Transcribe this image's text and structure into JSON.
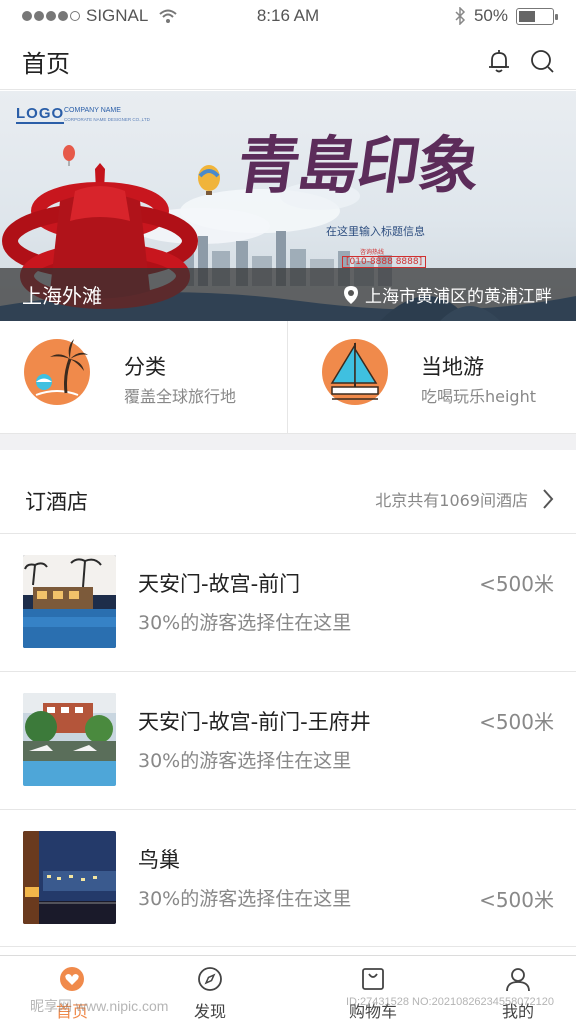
{
  "status_bar": {
    "carrier": "SIGNAL",
    "time": "8:16 AM",
    "battery": "50%",
    "battery_level": 0.5
  },
  "header": {
    "title": "首页",
    "icons": [
      "bell-icon",
      "search-icon"
    ]
  },
  "banner": {
    "logo_text": "LOGO",
    "company_name": "COMPANY NAME",
    "company_sub": "CORPORATE NAME DESIGNER CO.,LTD",
    "title": "青島印象",
    "subtitle": "在这里输入标题信息",
    "hotline_label": "咨询热线",
    "hotline": "[010-8888 8888]",
    "place_name": "上海外滩",
    "address": "上海市黄浦区的黄浦江畔"
  },
  "quick_links": [
    {
      "title": "分类",
      "desc": "覆盖全球旅行地",
      "icon": "palm-tree-icon"
    },
    {
      "title": "当地游",
      "desc": "吃喝玩乐height",
      "icon": "sailboat-icon"
    }
  ],
  "hotels": {
    "section_title": "订酒店",
    "more_text": "北京共有1069间酒店",
    "items": [
      {
        "name": "天安门-故宫-前门",
        "desc": "30%的游客选择住在这里",
        "distance": "<500米"
      },
      {
        "name": "天安门-故宫-前门-王府井",
        "desc": "30%的游客选择住在这里",
        "distance": "<500米"
      },
      {
        "name": "鸟巢",
        "desc": "30%的游客选择住在这里",
        "distance": "<500米"
      }
    ]
  },
  "tabbar": {
    "tabs": [
      {
        "label": "首页",
        "icon": "heart-icon",
        "active": true
      },
      {
        "label": "发现",
        "icon": "compass-icon",
        "active": false
      },
      {
        "label": "购物车",
        "icon": "shopping-bag-icon",
        "active": false
      },
      {
        "label": "我的",
        "icon": "user-icon",
        "active": false
      }
    ]
  },
  "watermark": {
    "text": "昵享网 www.nipic.com",
    "id": "ID:27431528 NO:20210826234558072120"
  },
  "colors": {
    "accent": "#f08a4b",
    "text_primary": "#222222",
    "text_secondary": "#888888",
    "divider": "#e6e6e6"
  }
}
